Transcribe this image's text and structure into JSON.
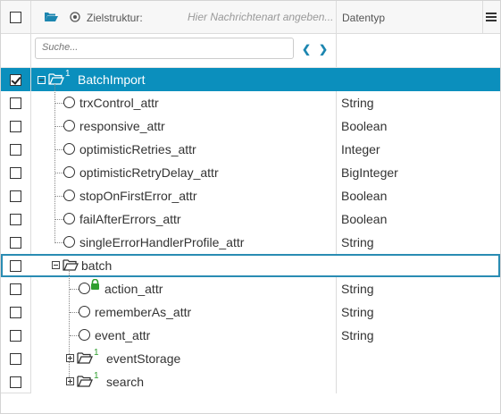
{
  "header": {
    "target_label": "Zielstruktur:",
    "target_placeholder": "Hier Nachrichtenart angeben...",
    "type_column": "Datentyp"
  },
  "search": {
    "placeholder": "Suche..."
  },
  "rows": [
    {
      "label": "BatchImport",
      "badge": "1",
      "type": "",
      "selected": true,
      "checked": true
    },
    {
      "label": "trxControl_attr",
      "type": "String"
    },
    {
      "label": "responsive_attr",
      "type": "Boolean"
    },
    {
      "label": "optimisticRetries_attr",
      "type": "Integer"
    },
    {
      "label": "optimisticRetryDelay_attr",
      "type": "BigInteger"
    },
    {
      "label": "stopOnFirstError_attr",
      "type": "Boolean"
    },
    {
      "label": "failAfterErrors_attr",
      "type": "Boolean"
    },
    {
      "label": "singleErrorHandlerProfile_attr",
      "type": "String"
    },
    {
      "label": "batch",
      "type": "",
      "focused": true
    },
    {
      "label": "action_attr",
      "type": "String",
      "locked": true
    },
    {
      "label": "rememberAs_attr",
      "type": "String"
    },
    {
      "label": "event_attr",
      "type": "String"
    },
    {
      "label": "eventStorage",
      "badge": "1",
      "type": ""
    },
    {
      "label": "search",
      "badge": "1",
      "type": ""
    }
  ],
  "colors": {
    "selection": "#0b8fbd",
    "accent": "#1c86b0",
    "badge": "#2f9e2f",
    "lock": "#2f9e2f"
  },
  "icons": [
    "folder-open-icon",
    "target-icon",
    "menu-icon",
    "chevron-left-icon",
    "chevron-right-icon",
    "lock-icon"
  ]
}
